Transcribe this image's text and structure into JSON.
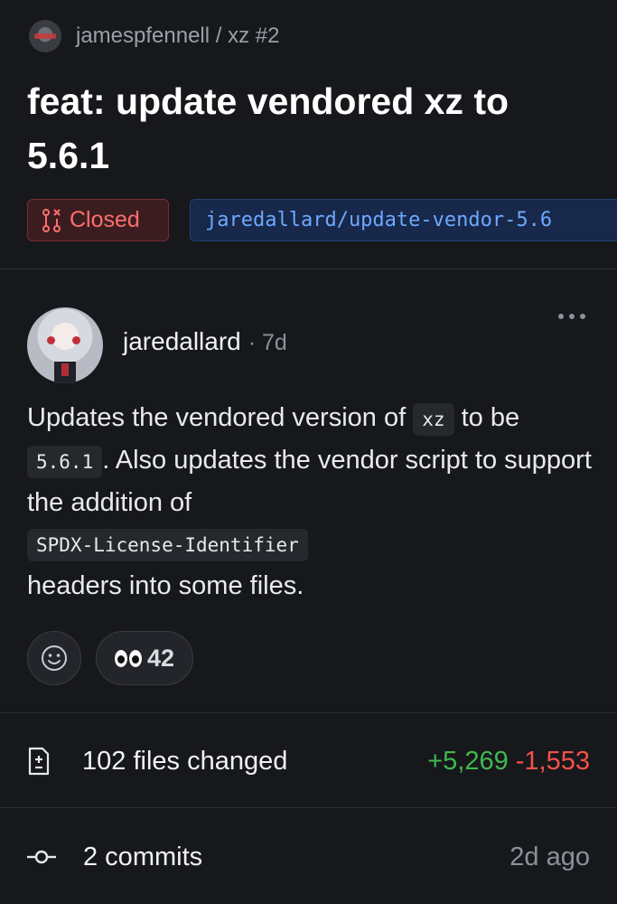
{
  "header": {
    "repo_path": "jamespfennell / xz #2",
    "title": "feat: update vendored xz to 5.6.1"
  },
  "status": {
    "state_label": "Closed",
    "branch": "jaredallard/update-vendor-5.6"
  },
  "comment": {
    "author": "jaredallard",
    "time": "· 7d",
    "body": {
      "part1": "Updates the vendored version of ",
      "code1": "xz",
      "part2": " to be ",
      "code2": "5.6.1",
      "part3": ". Also updates the vendor script to support the addition of ",
      "code3": "SPDX-License-Identifier",
      "part4": " headers into some files."
    },
    "reactions": {
      "eyes_count": "42"
    }
  },
  "summary": {
    "files_label": "102 files changed",
    "additions": "+5,269",
    "deletions": "-1,553",
    "commits_label": "2 commits",
    "commits_time": "2d ago"
  },
  "colors": {
    "closed": "#ff6e6e",
    "branch": "#6ea8ff",
    "additions": "#3fb950",
    "deletions": "#f85149"
  }
}
